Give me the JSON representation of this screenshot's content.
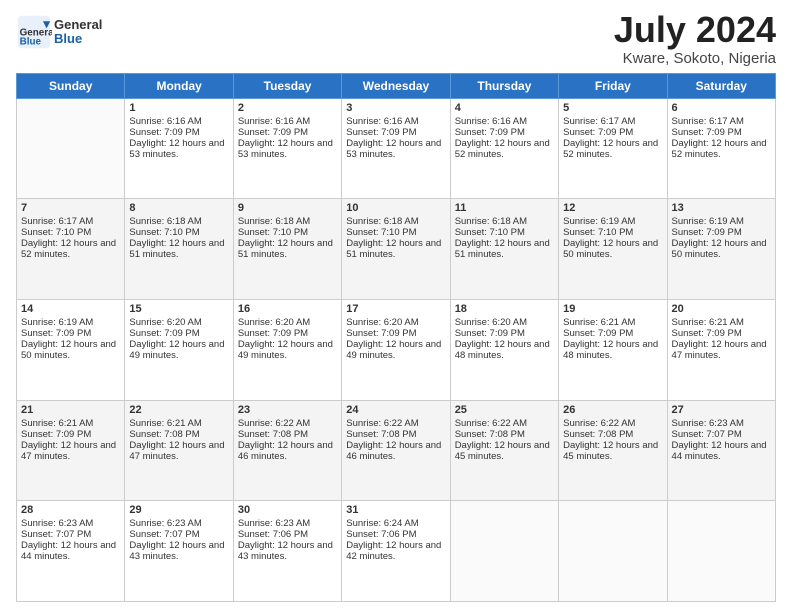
{
  "header": {
    "logo_general": "General",
    "logo_blue": "Blue",
    "month_year": "July 2024",
    "location": "Kware, Sokoto, Nigeria"
  },
  "days_of_week": [
    "Sunday",
    "Monday",
    "Tuesday",
    "Wednesday",
    "Thursday",
    "Friday",
    "Saturday"
  ],
  "weeks": [
    [
      {
        "day": "",
        "sunrise": "",
        "sunset": "",
        "daylight": ""
      },
      {
        "day": "1",
        "sunrise": "6:16 AM",
        "sunset": "7:09 PM",
        "daylight": "12 hours and 53 minutes."
      },
      {
        "day": "2",
        "sunrise": "6:16 AM",
        "sunset": "7:09 PM",
        "daylight": "12 hours and 53 minutes."
      },
      {
        "day": "3",
        "sunrise": "6:16 AM",
        "sunset": "7:09 PM",
        "daylight": "12 hours and 53 minutes."
      },
      {
        "day": "4",
        "sunrise": "6:16 AM",
        "sunset": "7:09 PM",
        "daylight": "12 hours and 52 minutes."
      },
      {
        "day": "5",
        "sunrise": "6:17 AM",
        "sunset": "7:09 PM",
        "daylight": "12 hours and 52 minutes."
      },
      {
        "day": "6",
        "sunrise": "6:17 AM",
        "sunset": "7:09 PM",
        "daylight": "12 hours and 52 minutes."
      }
    ],
    [
      {
        "day": "7",
        "sunrise": "6:17 AM",
        "sunset": "7:10 PM",
        "daylight": "12 hours and 52 minutes."
      },
      {
        "day": "8",
        "sunrise": "6:18 AM",
        "sunset": "7:10 PM",
        "daylight": "12 hours and 51 minutes."
      },
      {
        "day": "9",
        "sunrise": "6:18 AM",
        "sunset": "7:10 PM",
        "daylight": "12 hours and 51 minutes."
      },
      {
        "day": "10",
        "sunrise": "6:18 AM",
        "sunset": "7:10 PM",
        "daylight": "12 hours and 51 minutes."
      },
      {
        "day": "11",
        "sunrise": "6:18 AM",
        "sunset": "7:10 PM",
        "daylight": "12 hours and 51 minutes."
      },
      {
        "day": "12",
        "sunrise": "6:19 AM",
        "sunset": "7:10 PM",
        "daylight": "12 hours and 50 minutes."
      },
      {
        "day": "13",
        "sunrise": "6:19 AM",
        "sunset": "7:09 PM",
        "daylight": "12 hours and 50 minutes."
      }
    ],
    [
      {
        "day": "14",
        "sunrise": "6:19 AM",
        "sunset": "7:09 PM",
        "daylight": "12 hours and 50 minutes."
      },
      {
        "day": "15",
        "sunrise": "6:20 AM",
        "sunset": "7:09 PM",
        "daylight": "12 hours and 49 minutes."
      },
      {
        "day": "16",
        "sunrise": "6:20 AM",
        "sunset": "7:09 PM",
        "daylight": "12 hours and 49 minutes."
      },
      {
        "day": "17",
        "sunrise": "6:20 AM",
        "sunset": "7:09 PM",
        "daylight": "12 hours and 49 minutes."
      },
      {
        "day": "18",
        "sunrise": "6:20 AM",
        "sunset": "7:09 PM",
        "daylight": "12 hours and 48 minutes."
      },
      {
        "day": "19",
        "sunrise": "6:21 AM",
        "sunset": "7:09 PM",
        "daylight": "12 hours and 48 minutes."
      },
      {
        "day": "20",
        "sunrise": "6:21 AM",
        "sunset": "7:09 PM",
        "daylight": "12 hours and 47 minutes."
      }
    ],
    [
      {
        "day": "21",
        "sunrise": "6:21 AM",
        "sunset": "7:09 PM",
        "daylight": "12 hours and 47 minutes."
      },
      {
        "day": "22",
        "sunrise": "6:21 AM",
        "sunset": "7:08 PM",
        "daylight": "12 hours and 47 minutes."
      },
      {
        "day": "23",
        "sunrise": "6:22 AM",
        "sunset": "7:08 PM",
        "daylight": "12 hours and 46 minutes."
      },
      {
        "day": "24",
        "sunrise": "6:22 AM",
        "sunset": "7:08 PM",
        "daylight": "12 hours and 46 minutes."
      },
      {
        "day": "25",
        "sunrise": "6:22 AM",
        "sunset": "7:08 PM",
        "daylight": "12 hours and 45 minutes."
      },
      {
        "day": "26",
        "sunrise": "6:22 AM",
        "sunset": "7:08 PM",
        "daylight": "12 hours and 45 minutes."
      },
      {
        "day": "27",
        "sunrise": "6:23 AM",
        "sunset": "7:07 PM",
        "daylight": "12 hours and 44 minutes."
      }
    ],
    [
      {
        "day": "28",
        "sunrise": "6:23 AM",
        "sunset": "7:07 PM",
        "daylight": "12 hours and 44 minutes."
      },
      {
        "day": "29",
        "sunrise": "6:23 AM",
        "sunset": "7:07 PM",
        "daylight": "12 hours and 43 minutes."
      },
      {
        "day": "30",
        "sunrise": "6:23 AM",
        "sunset": "7:06 PM",
        "daylight": "12 hours and 43 minutes."
      },
      {
        "day": "31",
        "sunrise": "6:24 AM",
        "sunset": "7:06 PM",
        "daylight": "12 hours and 42 minutes."
      },
      {
        "day": "",
        "sunrise": "",
        "sunset": "",
        "daylight": ""
      },
      {
        "day": "",
        "sunrise": "",
        "sunset": "",
        "daylight": ""
      },
      {
        "day": "",
        "sunrise": "",
        "sunset": "",
        "daylight": ""
      }
    ]
  ]
}
